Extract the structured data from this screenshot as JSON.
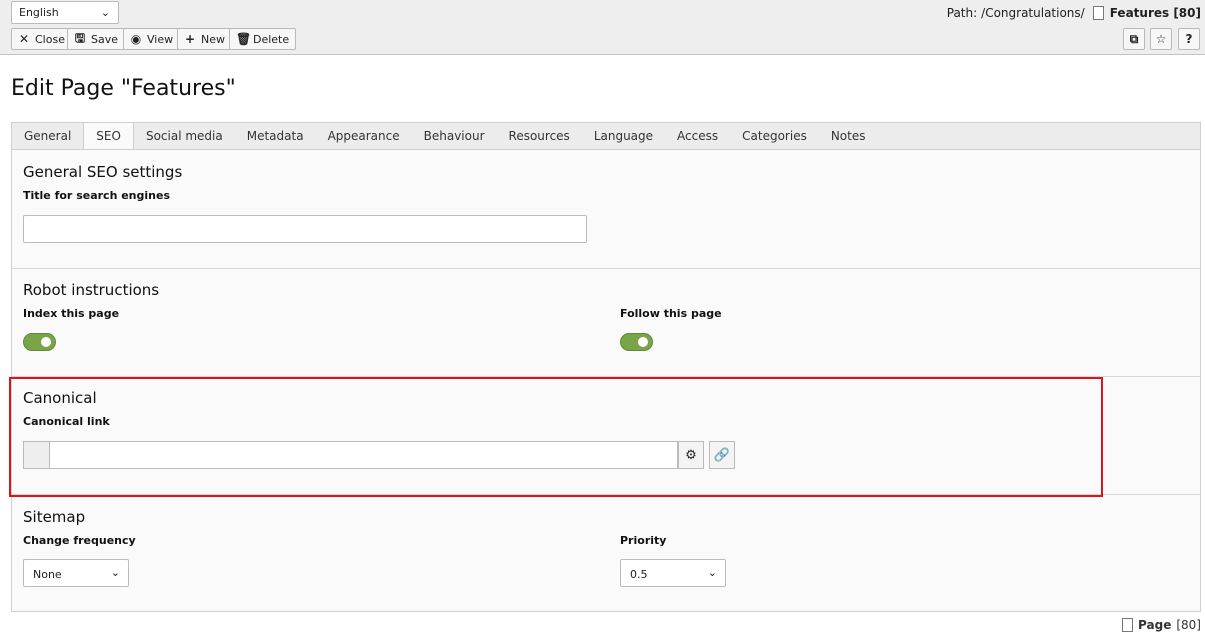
{
  "language_select": {
    "value": "English"
  },
  "path": {
    "label": "Path:",
    "value": "/Congratulations/",
    "page": "Features [80]"
  },
  "toolbar": {
    "close_label": "Close",
    "save_label": "Save",
    "view_label": "View",
    "new_label": "New",
    "delete_label": "Delete",
    "help_label": "?"
  },
  "title": "Edit Page \"Features\"",
  "tabs": [
    "General",
    "SEO",
    "Social media",
    "Metadata",
    "Appearance",
    "Behaviour",
    "Resources",
    "Language",
    "Access",
    "Categories",
    "Notes"
  ],
  "active_tab": "SEO",
  "sections": {
    "general_seo": {
      "title": "General SEO settings",
      "title_field_label": "Title for search engines",
      "title_field_value": ""
    },
    "robot": {
      "title": "Robot instructions",
      "index_label": "Index this page",
      "index_enabled": true,
      "follow_label": "Follow this page",
      "follow_enabled": true
    },
    "canonical": {
      "title": "Canonical",
      "link_label": "Canonical link",
      "link_value": ""
    },
    "sitemap": {
      "title": "Sitemap",
      "change_frequency_label": "Change frequency",
      "change_frequency_value": "None",
      "priority_label": "Priority",
      "priority_value": "0.5"
    }
  },
  "footer": {
    "label": "Page",
    "id": "[80]"
  },
  "colors": {
    "toggle_on": "#79a548",
    "highlight": "#d9161d"
  }
}
